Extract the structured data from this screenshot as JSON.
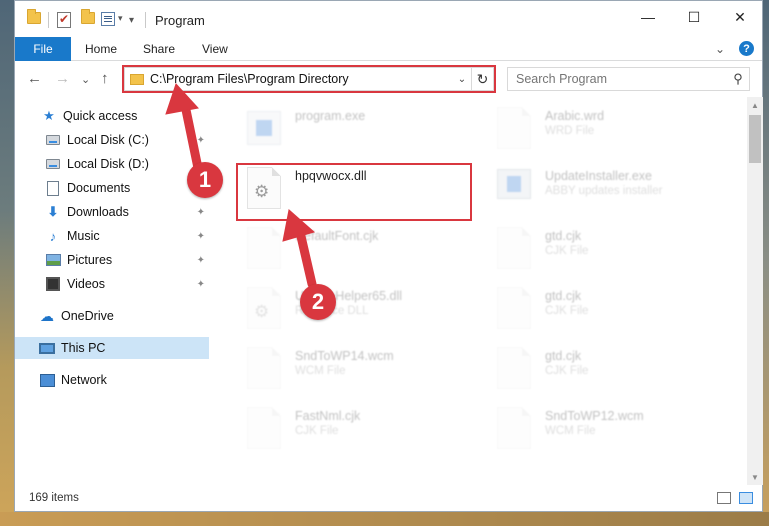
{
  "window": {
    "title": "Program",
    "qa_dropdown": "▾",
    "min_glyph": "—",
    "max_glyph": "☐",
    "close_glyph": "✕"
  },
  "ribbon": {
    "tabs": [
      "File",
      "Home",
      "Share",
      "View"
    ],
    "expand_glyph": "⌄",
    "help_glyph": "?"
  },
  "nav": {
    "back_glyph": "←",
    "forward_glyph": "→",
    "recent_glyph": "⌄",
    "up_glyph": "↑",
    "address": "C:\\Program Files\\Program Directory",
    "address_drop_glyph": "⌄",
    "refresh_glyph": "↻",
    "search_placeholder": "Search Program",
    "search_glyph": "⚲"
  },
  "sidebar": {
    "items": [
      {
        "label": "Quick access",
        "icon": "star-icon"
      },
      {
        "label": "Local Disk (C:)",
        "icon": "disk-icon",
        "pinned": true
      },
      {
        "label": "Local Disk (D:)",
        "icon": "disk-icon"
      },
      {
        "label": "Documents",
        "icon": "documents-icon",
        "pinned": true
      },
      {
        "label": "Downloads",
        "icon": "download-icon",
        "pinned": true
      },
      {
        "label": "Music",
        "icon": "music-icon",
        "pinned": true
      },
      {
        "label": "Pictures",
        "icon": "pictures-icon",
        "pinned": true
      },
      {
        "label": "Videos",
        "icon": "videos-icon",
        "pinned": true
      },
      {
        "label": "OneDrive",
        "icon": "cloud-icon"
      },
      {
        "label": "This PC",
        "icon": "computer-icon",
        "selected": true
      },
      {
        "label": "Network",
        "icon": "network-icon"
      }
    ],
    "pin_glyph": "📌"
  },
  "files": {
    "left": [
      {
        "name": "program.exe",
        "type": "",
        "faded": true
      },
      {
        "name": "hpqvwocx.dll",
        "type": "",
        "faded": false
      },
      {
        "name": "DefaultFont.cjk",
        "type": "",
        "faded": true
      },
      {
        "name": "UpdateHelper65.dll",
        "type": "Resource DLL",
        "faded": true
      },
      {
        "name": "SndToWP14.wcm",
        "type": "WCM File",
        "faded": true
      },
      {
        "name": "FastNml.cjk",
        "type": "CJK File",
        "faded": true
      }
    ],
    "right": [
      {
        "name": "Arabic.wrd",
        "type": "WRD File",
        "faded": true
      },
      {
        "name": "UpdateInstaller.exe",
        "type": "ABBY updates installer",
        "faded": true
      },
      {
        "name": "gtd.cjk",
        "type": "CJK File",
        "faded": true
      },
      {
        "name": "gtd.cjk",
        "type": "CJK File",
        "faded": true
      },
      {
        "name": "gtd.cjk",
        "type": "CJK File",
        "faded": true
      },
      {
        "name": "SndToWP12.wcm",
        "type": "WCM File",
        "faded": true
      }
    ]
  },
  "status": {
    "item_count": "169 items"
  },
  "annotations": {
    "step1": "1",
    "step2": "2",
    "accent_color": "#d9373f"
  }
}
